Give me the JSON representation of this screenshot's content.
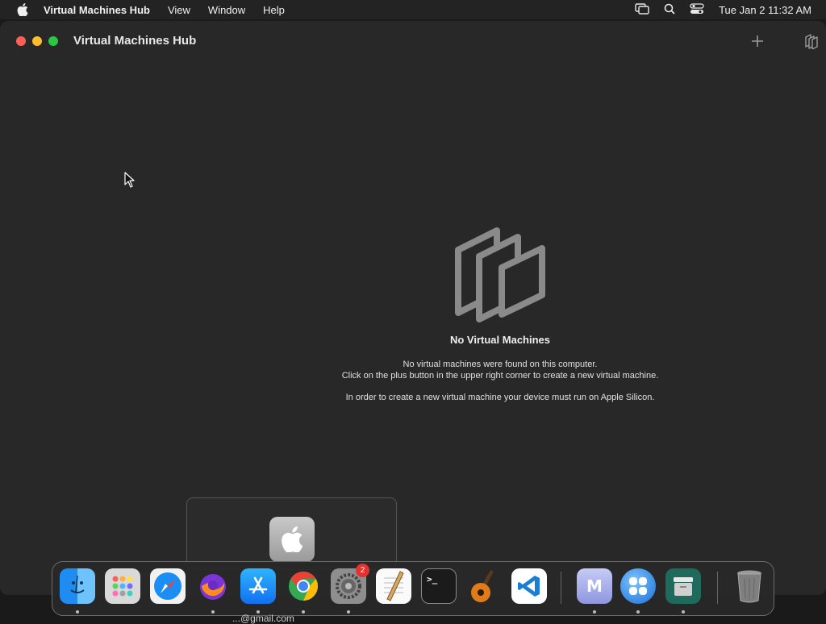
{
  "menubar": {
    "app_name": "Virtual Machines Hub",
    "items": [
      "View",
      "Window",
      "Help"
    ],
    "clock": "Tue Jan 2  11:32 AM",
    "status_icons": [
      "screen-mirroring-icon",
      "spotlight-search-icon",
      "control-center-icon"
    ]
  },
  "window": {
    "title": "Virtual Machines Hub",
    "toolbar_icons": [
      "plus-icon",
      "virtual-machine-icon"
    ]
  },
  "empty_state": {
    "title": "No Virtual Machines",
    "line1": "No virtual machines were found on this computer.",
    "line2": "Click on the plus button in the upper right corner to create a new virtual machine.",
    "note": "In order to create a new virtual machine your device must run on Apple Silicon."
  },
  "popover": {
    "icon": "apple-macos-icon"
  },
  "dock": {
    "apps": [
      {
        "name": "Finder",
        "icon": "finder-icon",
        "running": true
      },
      {
        "name": "Launchpad",
        "icon": "launchpad-icon",
        "running": false
      },
      {
        "name": "Safari",
        "icon": "safari-icon",
        "running": false
      },
      {
        "name": "Firefox",
        "icon": "firefox-icon",
        "running": true
      },
      {
        "name": "App Store",
        "icon": "app-store-icon",
        "running": true
      },
      {
        "name": "Chrome",
        "icon": "chrome-icon",
        "running": true
      },
      {
        "name": "System Settings",
        "icon": "system-settings-icon",
        "running": true,
        "badge": "2"
      },
      {
        "name": "TextEdit",
        "icon": "textedit-icon",
        "running": false
      },
      {
        "name": "Terminal",
        "icon": "terminal-icon",
        "running": false
      },
      {
        "name": "GarageBand",
        "icon": "garageband-icon",
        "running": false
      },
      {
        "name": "Visual Studio Code",
        "icon": "vscode-icon",
        "running": false
      },
      {
        "name": "M",
        "icon": "m-app-icon",
        "running": true
      },
      {
        "name": "Virtual Machines Hub",
        "icon": "vm-hub-icon",
        "running": true
      },
      {
        "name": "Archive",
        "icon": "archive-icon",
        "running": true
      },
      {
        "name": "Trash",
        "icon": "trash-icon",
        "running": false
      }
    ],
    "m_label": "M",
    "terminal_prompt": ">_"
  },
  "below_dock_text": "...@gmail.com",
  "colors": {
    "close": "#ff5f57",
    "minimize": "#febc2e",
    "maximize": "#28c840",
    "badge": "#e6312e"
  }
}
